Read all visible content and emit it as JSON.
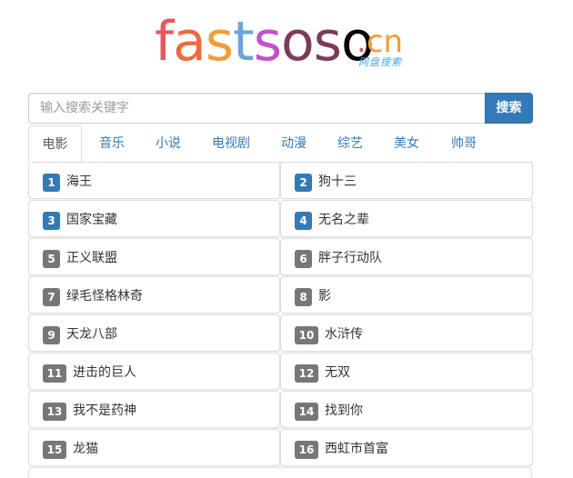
{
  "logo": {
    "letters": [
      "f",
      "a",
      "s",
      "t",
      "s",
      "o",
      "s",
      "o"
    ],
    "tld_dot": ".",
    "tld": "cn",
    "subtitle": "网盘搜索"
  },
  "search": {
    "placeholder": "输入搜索关键字",
    "button_label": "搜索"
  },
  "tabs": [
    {
      "label": "电影",
      "active": true
    },
    {
      "label": "音乐",
      "active": false
    },
    {
      "label": "小说",
      "active": false
    },
    {
      "label": "电视剧",
      "active": false
    },
    {
      "label": "动漫",
      "active": false
    },
    {
      "label": "综艺",
      "active": false
    },
    {
      "label": "美女",
      "active": false
    },
    {
      "label": "帅哥",
      "active": false
    }
  ],
  "results": [
    {
      "rank": "1",
      "title": "海王",
      "highlight": true
    },
    {
      "rank": "2",
      "title": "狗十三",
      "highlight": true
    },
    {
      "rank": "3",
      "title": "国家宝藏",
      "highlight": true
    },
    {
      "rank": "4",
      "title": "无名之辈",
      "highlight": true
    },
    {
      "rank": "5",
      "title": "正义联盟",
      "highlight": false
    },
    {
      "rank": "6",
      "title": "胖子行动队",
      "highlight": false
    },
    {
      "rank": "7",
      "title": "绿毛怪格林奇",
      "highlight": false
    },
    {
      "rank": "8",
      "title": "影",
      "highlight": false
    },
    {
      "rank": "9",
      "title": "天龙八部",
      "highlight": false
    },
    {
      "rank": "10",
      "title": "水浒传",
      "highlight": false
    },
    {
      "rank": "11",
      "title": "进击的巨人",
      "highlight": false
    },
    {
      "rank": "12",
      "title": "无双",
      "highlight": false
    },
    {
      "rank": "13",
      "title": "我不是药神",
      "highlight": false
    },
    {
      "rank": "14",
      "title": "找到你",
      "highlight": false
    },
    {
      "rank": "15",
      "title": "龙猫",
      "highlight": false
    },
    {
      "rank": "16",
      "title": "西虹市首富",
      "highlight": false
    }
  ],
  "colors": {
    "primary": "#337ab7",
    "badge_gray": "#777777"
  }
}
